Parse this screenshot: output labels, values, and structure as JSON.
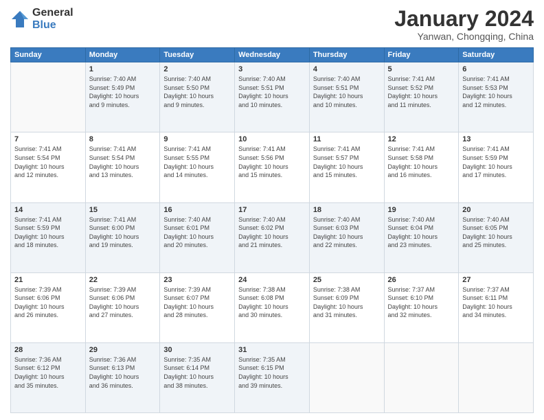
{
  "header": {
    "logo_general": "General",
    "logo_blue": "Blue",
    "month_title": "January 2024",
    "location": "Yanwan, Chongqing, China"
  },
  "days_of_week": [
    "Sunday",
    "Monday",
    "Tuesday",
    "Wednesday",
    "Thursday",
    "Friday",
    "Saturday"
  ],
  "weeks": [
    [
      {
        "day": "",
        "info": ""
      },
      {
        "day": "1",
        "info": "Sunrise: 7:40 AM\nSunset: 5:49 PM\nDaylight: 10 hours\nand 9 minutes."
      },
      {
        "day": "2",
        "info": "Sunrise: 7:40 AM\nSunset: 5:50 PM\nDaylight: 10 hours\nand 9 minutes."
      },
      {
        "day": "3",
        "info": "Sunrise: 7:40 AM\nSunset: 5:51 PM\nDaylight: 10 hours\nand 10 minutes."
      },
      {
        "day": "4",
        "info": "Sunrise: 7:40 AM\nSunset: 5:51 PM\nDaylight: 10 hours\nand 10 minutes."
      },
      {
        "day": "5",
        "info": "Sunrise: 7:41 AM\nSunset: 5:52 PM\nDaylight: 10 hours\nand 11 minutes."
      },
      {
        "day": "6",
        "info": "Sunrise: 7:41 AM\nSunset: 5:53 PM\nDaylight: 10 hours\nand 12 minutes."
      }
    ],
    [
      {
        "day": "7",
        "info": "Sunrise: 7:41 AM\nSunset: 5:54 PM\nDaylight: 10 hours\nand 12 minutes."
      },
      {
        "day": "8",
        "info": "Sunrise: 7:41 AM\nSunset: 5:54 PM\nDaylight: 10 hours\nand 13 minutes."
      },
      {
        "day": "9",
        "info": "Sunrise: 7:41 AM\nSunset: 5:55 PM\nDaylight: 10 hours\nand 14 minutes."
      },
      {
        "day": "10",
        "info": "Sunrise: 7:41 AM\nSunset: 5:56 PM\nDaylight: 10 hours\nand 15 minutes."
      },
      {
        "day": "11",
        "info": "Sunrise: 7:41 AM\nSunset: 5:57 PM\nDaylight: 10 hours\nand 15 minutes."
      },
      {
        "day": "12",
        "info": "Sunrise: 7:41 AM\nSunset: 5:58 PM\nDaylight: 10 hours\nand 16 minutes."
      },
      {
        "day": "13",
        "info": "Sunrise: 7:41 AM\nSunset: 5:59 PM\nDaylight: 10 hours\nand 17 minutes."
      }
    ],
    [
      {
        "day": "14",
        "info": "Sunrise: 7:41 AM\nSunset: 5:59 PM\nDaylight: 10 hours\nand 18 minutes."
      },
      {
        "day": "15",
        "info": "Sunrise: 7:41 AM\nSunset: 6:00 PM\nDaylight: 10 hours\nand 19 minutes."
      },
      {
        "day": "16",
        "info": "Sunrise: 7:40 AM\nSunset: 6:01 PM\nDaylight: 10 hours\nand 20 minutes."
      },
      {
        "day": "17",
        "info": "Sunrise: 7:40 AM\nSunset: 6:02 PM\nDaylight: 10 hours\nand 21 minutes."
      },
      {
        "day": "18",
        "info": "Sunrise: 7:40 AM\nSunset: 6:03 PM\nDaylight: 10 hours\nand 22 minutes."
      },
      {
        "day": "19",
        "info": "Sunrise: 7:40 AM\nSunset: 6:04 PM\nDaylight: 10 hours\nand 23 minutes."
      },
      {
        "day": "20",
        "info": "Sunrise: 7:40 AM\nSunset: 6:05 PM\nDaylight: 10 hours\nand 25 minutes."
      }
    ],
    [
      {
        "day": "21",
        "info": "Sunrise: 7:39 AM\nSunset: 6:06 PM\nDaylight: 10 hours\nand 26 minutes."
      },
      {
        "day": "22",
        "info": "Sunrise: 7:39 AM\nSunset: 6:06 PM\nDaylight: 10 hours\nand 27 minutes."
      },
      {
        "day": "23",
        "info": "Sunrise: 7:39 AM\nSunset: 6:07 PM\nDaylight: 10 hours\nand 28 minutes."
      },
      {
        "day": "24",
        "info": "Sunrise: 7:38 AM\nSunset: 6:08 PM\nDaylight: 10 hours\nand 30 minutes."
      },
      {
        "day": "25",
        "info": "Sunrise: 7:38 AM\nSunset: 6:09 PM\nDaylight: 10 hours\nand 31 minutes."
      },
      {
        "day": "26",
        "info": "Sunrise: 7:37 AM\nSunset: 6:10 PM\nDaylight: 10 hours\nand 32 minutes."
      },
      {
        "day": "27",
        "info": "Sunrise: 7:37 AM\nSunset: 6:11 PM\nDaylight: 10 hours\nand 34 minutes."
      }
    ],
    [
      {
        "day": "28",
        "info": "Sunrise: 7:36 AM\nSunset: 6:12 PM\nDaylight: 10 hours\nand 35 minutes."
      },
      {
        "day": "29",
        "info": "Sunrise: 7:36 AM\nSunset: 6:13 PM\nDaylight: 10 hours\nand 36 minutes."
      },
      {
        "day": "30",
        "info": "Sunrise: 7:35 AM\nSunset: 6:14 PM\nDaylight: 10 hours\nand 38 minutes."
      },
      {
        "day": "31",
        "info": "Sunrise: 7:35 AM\nSunset: 6:15 PM\nDaylight: 10 hours\nand 39 minutes."
      },
      {
        "day": "",
        "info": ""
      },
      {
        "day": "",
        "info": ""
      },
      {
        "day": "",
        "info": ""
      }
    ]
  ]
}
